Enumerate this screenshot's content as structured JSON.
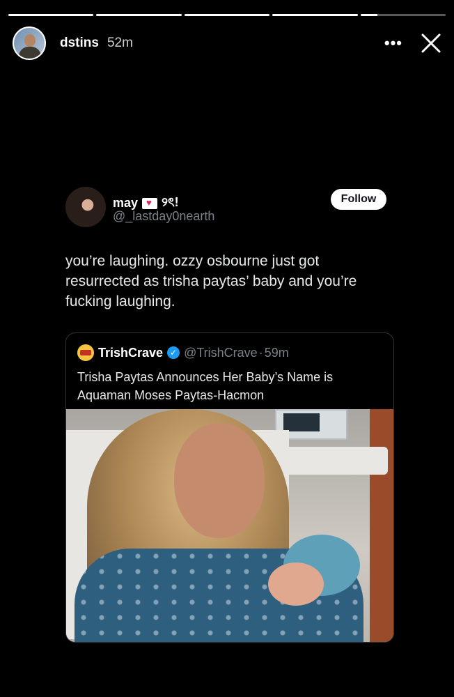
{
  "story": {
    "segments": [
      1,
      1,
      1,
      1,
      0.2
    ],
    "username": "dstins",
    "time": "52m",
    "more_icon": "more-options-icon",
    "close_icon": "close-icon"
  },
  "tweet": {
    "display_name": "may",
    "name_suffix": "୨ৎ!",
    "handle": "@_lastday0nearth",
    "follow_label": "Follow",
    "text": "you’re laughing. ozzy osbourne just got resurrected as trisha paytas’ baby and you’re fucking laughing.",
    "quote": {
      "name": "TrishCrave",
      "handle": "@TrishCrave",
      "separator": "·",
      "time": "59m",
      "text": "Trisha Paytas Announces Her Baby’s Name is Aquaman Moses Paytas-Hacmon"
    }
  },
  "colors": {
    "background": "#000000",
    "verified": "#1d9bf0",
    "handle": "#7b8188"
  }
}
